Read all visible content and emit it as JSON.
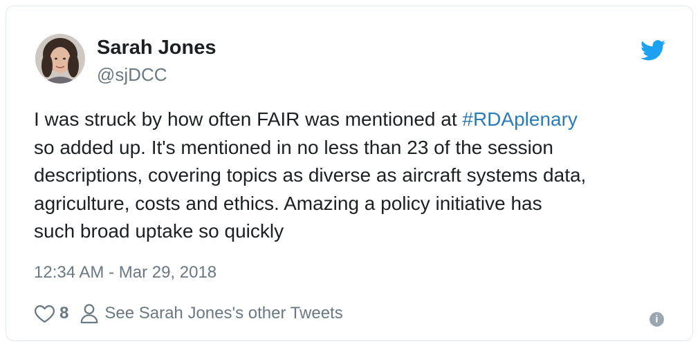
{
  "author": {
    "name": "Sarah Jones",
    "handle": "@sjDCC"
  },
  "tweet": {
    "line1_text": "I was struck by how often FAIR was mentioned at ",
    "hashtag": "#RDAplenary",
    "line2": "so added up. It's mentioned in no less than 23 of the session",
    "line3": "descriptions, covering topics as diverse as aircraft systems data,",
    "line4": "agriculture, costs and ethics. Amazing a policy initiative has",
    "line5": "such broad uptake so quickly"
  },
  "timestamp": "12:34 AM - Mar 29, 2018",
  "actions": {
    "like_count": "8",
    "profile_link_label": "See Sarah Jones's other Tweets"
  },
  "icons": {
    "brand": "twitter-bird-icon",
    "like": "heart-icon",
    "profile": "person-icon",
    "info": "info-icon"
  },
  "colors": {
    "twitter_blue": "#1da1f2",
    "hashtag": "#2b7bb9",
    "muted_text": "#697882",
    "body_text": "#1c2022"
  }
}
